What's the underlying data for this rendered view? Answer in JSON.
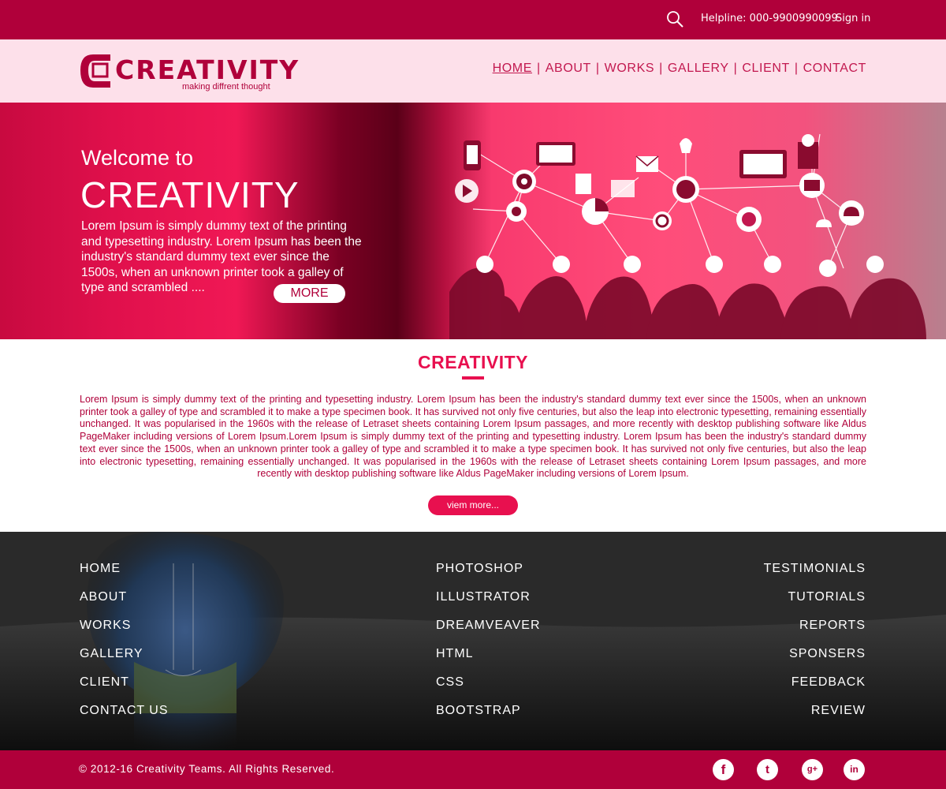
{
  "topbar": {
    "search_icon": "search-icon",
    "helpline": "Helpline: 000-9900990099",
    "signin": "Sign in"
  },
  "header": {
    "logo_text": "CREATIVITY",
    "logo_tagline": "making diffrent thought",
    "nav": [
      "HOME",
      "ABOUT",
      "WORKS",
      "GALLERY",
      "CLIENT",
      "CONTACT"
    ],
    "nav_active": "HOME"
  },
  "hero": {
    "welcome": "Welcome to",
    "title": "CREATIVITY",
    "text": "Lorem Ipsum is simply dummy text of the printing and typesetting industry. Lorem Ipsum has been the industry's standard dummy text ever since the 1500s, when an unknown printer took a galley of type and scrambled ....",
    "more_button": "MORE"
  },
  "intro": {
    "title": "CREATIVITY",
    "text": "Lorem Ipsum is simply dummy text of the printing and typesetting industry. Lorem Ipsum has been the industry's standard dummy text ever since the 1500s, when an unknown printer took a galley of type and scrambled it to make a type specimen book. It has survived not only five centuries, but also the leap into electronic typesetting, remaining essentially unchanged. It was popularised in the 1960s with the release of Letraset sheets containing Lorem Ipsum passages, and more recently with desktop publishing software like Aldus PageMaker including versions of Lorem Ipsum.Lorem Ipsum is simply dummy text of the printing and typesetting industry. Lorem Ipsum has been the industry's standard dummy text ever since the 1500s, when an unknown printer took a galley of type and scrambled it to make a type specimen book. It has survived not only five centuries, but also the leap into electronic typesetting, remaining essentially unchanged. It was popularised in the 1960s with the release of Letraset sheets containing Lorem Ipsum passages, and more recently with desktop publishing software like Aldus PageMaker including versions of Lorem Ipsum.",
    "view_more": "viem more..."
  },
  "footer": {
    "col1": [
      "HOME",
      "ABOUT",
      "WORKS",
      "GALLERY",
      "CLIENT",
      "CONTACT US"
    ],
    "col2": [
      "PHOTOSHOP",
      "ILLUSTRATOR",
      "DREAMVEAVER",
      "HTML",
      "CSS",
      "BOOTSTRAP"
    ],
    "col3": [
      "TESTIMONIALS",
      "TUTORIALS",
      "REPORTS",
      "SPONSERS",
      "FEEDBACK",
      "REVIEW"
    ]
  },
  "bottombar": {
    "copyright": "© 2012-16 Creativity Teams. All Rights Reserved.",
    "social_icons": [
      "facebook-icon",
      "twitter-icon",
      "google-plus-icon",
      "linkedin-icon"
    ],
    "social_glyphs": [
      "f",
      "t",
      "g+",
      "in"
    ]
  },
  "colors": {
    "brand": "#b0003a",
    "accent": "#e8104f",
    "header_bg": "#fde0ea",
    "footer_bg": "#1d1d1d"
  }
}
